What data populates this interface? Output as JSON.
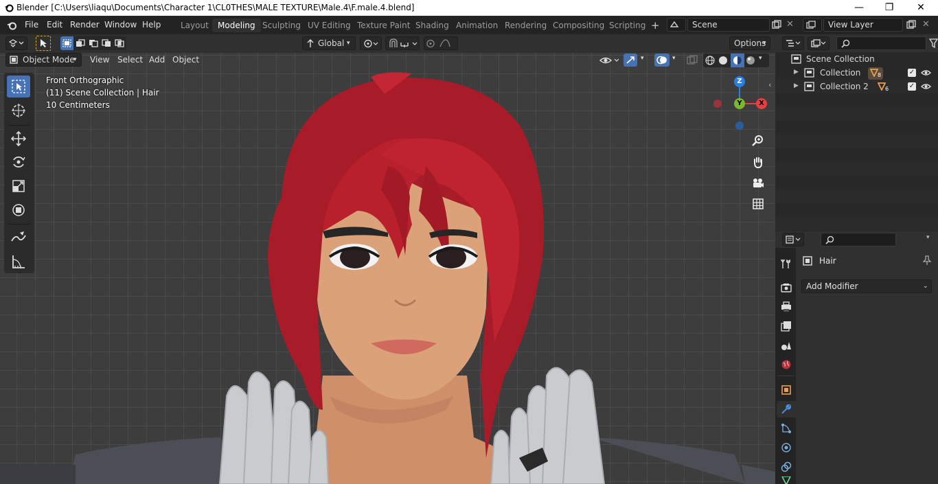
{
  "window": {
    "title": "Blender [C:\\Users\\liaqu\\Documents\\Character 1\\CL0THES\\MALE TEXTURE\\Male.4\\F.male.4.blend]",
    "minimize": "—",
    "maximize": "❐",
    "close": "✕"
  },
  "menu": {
    "items": [
      "File",
      "Edit",
      "Render",
      "Window",
      "Help"
    ]
  },
  "workspaces": {
    "tabs": [
      "Layout",
      "Modeling",
      "Sculpting",
      "UV Editing",
      "Texture Paint",
      "Shading",
      "Animation",
      "Rendering",
      "Compositing",
      "Scripting"
    ],
    "active": "Modeling",
    "add": "+"
  },
  "scene": {
    "name": "Scene",
    "view_layer": "View Layer"
  },
  "header": {
    "orientation": "Global",
    "options": "Options",
    "mode": "Object Mode",
    "view": "View",
    "select": "Select",
    "add": "Add",
    "object": "Object"
  },
  "viewport": {
    "view_name": "Front Orthographic",
    "collection_info": "(11) Scene Collection | Hair",
    "scale": "10 Centimeters",
    "gizmo_z": "Z",
    "gizmo_y": "Y",
    "gizmo_x": "X"
  },
  "outliner": {
    "root": "Scene Collection",
    "collections": [
      {
        "name": "Collection",
        "count": "8"
      },
      {
        "name": "Collection 2",
        "count": "6"
      }
    ]
  },
  "properties": {
    "object_name": "Hair",
    "add_modifier": "Add Modifier"
  },
  "colors": {
    "accent": "#4772b3",
    "hair": "#b8202c",
    "skin": "#dba27a",
    "gizmo_x": "#e4403f",
    "gizmo_y": "#7ab62e",
    "gizmo_z": "#2b7fe0"
  }
}
